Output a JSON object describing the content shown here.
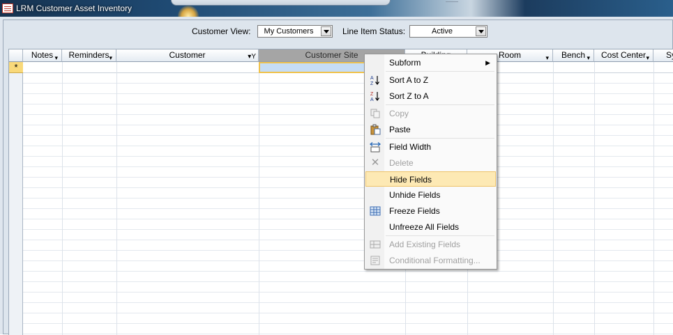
{
  "window": {
    "title": "LRM Customer Asset Inventory"
  },
  "filters": {
    "customer_view_label": "Customer View:",
    "customer_view_value": "My Customers",
    "line_item_status_label": "Line Item Status:",
    "line_item_status_value": "Active"
  },
  "columns": [
    "Notes",
    "Reminders",
    "Customer",
    "Customer Site",
    "Building",
    "Room",
    "Bench",
    "Cost Center",
    "Sy"
  ],
  "selected_column": "Customer Site",
  "new_record_glyph": "*",
  "context_menu": {
    "items": [
      {
        "label": "Subform",
        "icon": "none",
        "disabled": false,
        "submenu": true
      },
      {
        "label": "Sort A to Z",
        "icon": "sort-ascending-icon",
        "disabled": false
      },
      {
        "label": "Sort Z to A",
        "icon": "sort-descending-icon",
        "disabled": false
      },
      {
        "label": "Copy",
        "icon": "copy-icon",
        "disabled": true
      },
      {
        "label": "Paste",
        "icon": "paste-icon",
        "disabled": false
      },
      {
        "label": "Field Width",
        "icon": "field-width-icon",
        "disabled": false
      },
      {
        "label": "Delete",
        "icon": "delete-icon",
        "disabled": true
      },
      {
        "label": "Hide Fields",
        "icon": "none",
        "disabled": false,
        "highlighted": true
      },
      {
        "label": "Unhide Fields",
        "icon": "none",
        "disabled": false
      },
      {
        "label": "Freeze Fields",
        "icon": "freeze-fields-icon",
        "disabled": false
      },
      {
        "label": "Unfreeze All Fields",
        "icon": "none",
        "disabled": false
      },
      {
        "label": "Add Existing Fields",
        "icon": "add-existing-fields-icon",
        "disabled": true
      },
      {
        "label": "Conditional Formatting...",
        "icon": "conditional-formatting-icon",
        "disabled": true
      }
    ]
  },
  "colors": {
    "highlight": "#fde9b4",
    "selected_header": "#a5a5a5",
    "selected_cell": "#c6ddf5"
  }
}
